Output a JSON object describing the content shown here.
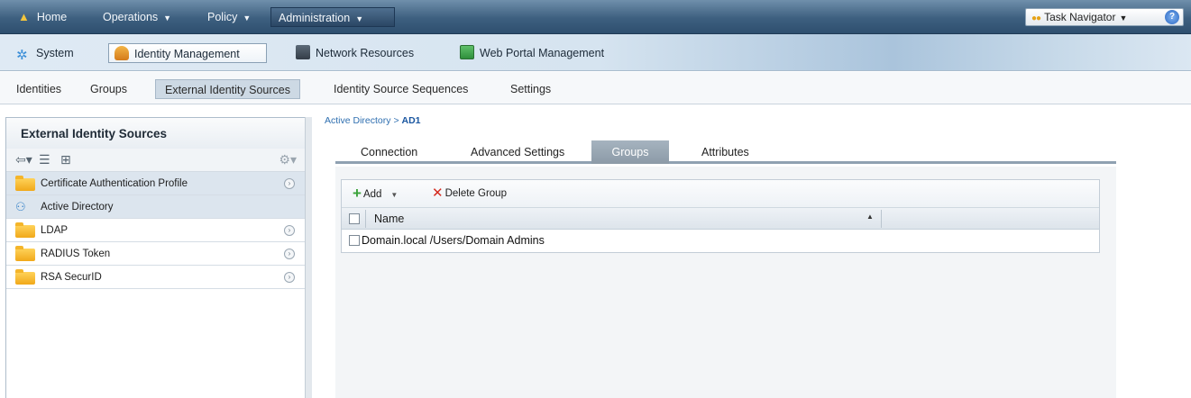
{
  "topnav": {
    "home": "Home",
    "operations": "Operations",
    "policy": "Policy",
    "administration": "Administration",
    "task_navigator": "Task Navigator"
  },
  "secnav": {
    "system": "System",
    "identity_management": "Identity Management",
    "network_resources": "Network Resources",
    "web_portal_management": "Web Portal Management"
  },
  "subnav": {
    "identities": "Identities",
    "groups": "Groups",
    "external_identity_sources": "External Identity Sources",
    "identity_source_sequences": "Identity Source Sequences",
    "settings": "Settings"
  },
  "leftpanel": {
    "title": "External Identity Sources",
    "items": [
      {
        "label": "Certificate Authentication Profile"
      },
      {
        "label": "Active Directory"
      },
      {
        "label": "LDAP"
      },
      {
        "label": "RADIUS Token"
      },
      {
        "label": "RSA SecurID"
      }
    ]
  },
  "breadcrumb": {
    "parent": "Active Directory",
    "separator": ">",
    "current": "AD1"
  },
  "tabs": [
    {
      "label": "Connection"
    },
    {
      "label": "Advanced Settings"
    },
    {
      "label": "Groups"
    },
    {
      "label": "Attributes"
    }
  ],
  "grid": {
    "add_label": "Add",
    "delete_label": "Delete Group",
    "column_name": "Name",
    "rows": [
      {
        "name": "Domain.local /Users/Domain Admins"
      }
    ]
  }
}
